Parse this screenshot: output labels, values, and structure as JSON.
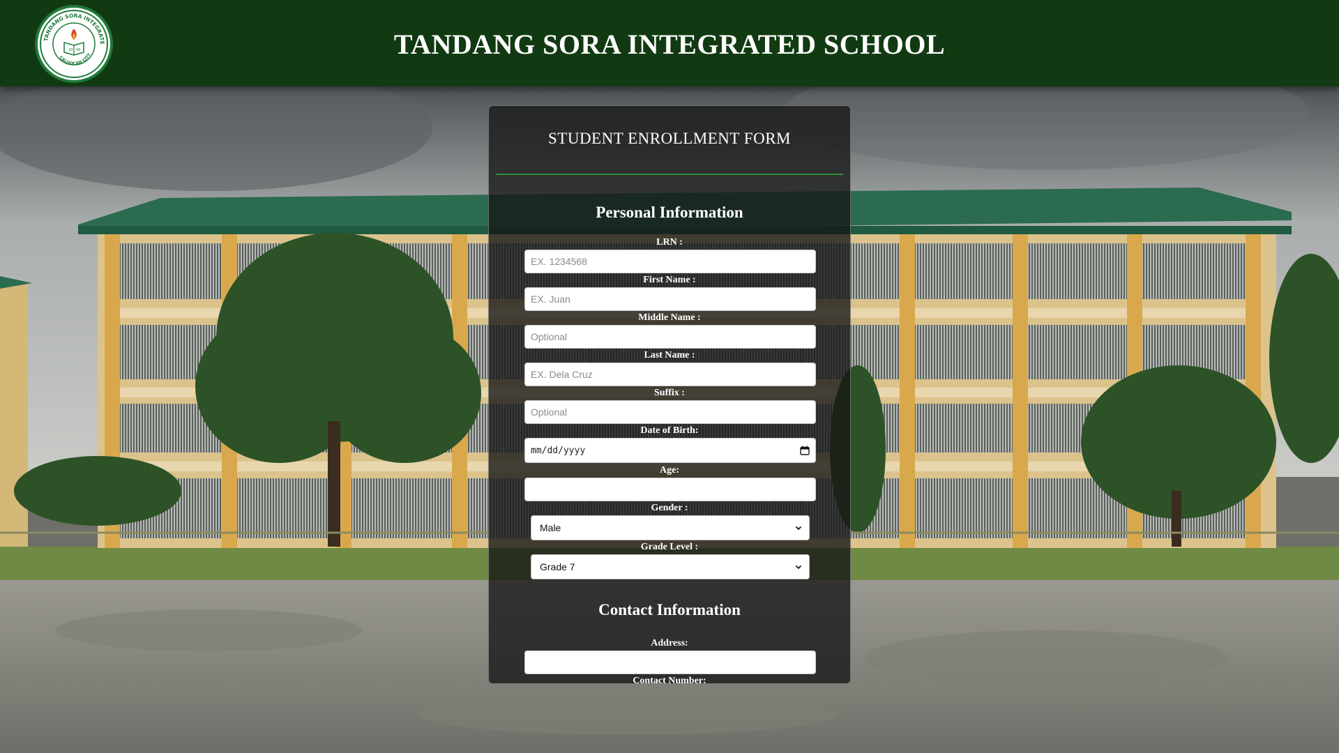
{
  "header": {
    "school_name": "TANDANG SORA INTEGRATED SCHOOL",
    "logo": {
      "ring_text": "TANDANG SORA INTEGRATED SCHOOL",
      "city_text": "CALOOCAN CITY",
      "year_left": "20",
      "year_right": "56"
    },
    "colors": {
      "bar": "#123a12",
      "text": "#ffffff"
    }
  },
  "form": {
    "title": "STUDENT ENROLLMENT FORM",
    "accent_color": "#2f8f3a",
    "personal": {
      "title": "Personal Information",
      "lrn": {
        "label": "LRN :",
        "placeholder": "EX. 1234568",
        "value": ""
      },
      "first_name": {
        "label": "First Name :",
        "placeholder": "EX. Juan",
        "value": ""
      },
      "middle_name": {
        "label": "Middle Name :",
        "placeholder": "Optional",
        "value": ""
      },
      "last_name": {
        "label": "Last Name :",
        "placeholder": "EX. Dela Cruz",
        "value": ""
      },
      "suffix": {
        "label": "Suffix :",
        "placeholder": "Optional",
        "value": ""
      },
      "dob": {
        "label": "Date of Birth:",
        "placeholder": "mm/dd/yyyy",
        "icon": "calendar-icon"
      },
      "age": {
        "label": "Age:",
        "value": ""
      },
      "gender": {
        "label": "Gender :",
        "selected": "Male",
        "icon": "chevron-down-icon"
      },
      "grade_level": {
        "label": "Grade Level :",
        "selected": "Grade 7",
        "icon": "chevron-down-icon"
      }
    },
    "contact": {
      "title": "Contact Information",
      "address": {
        "label": "Address:",
        "value": ""
      },
      "contact_number": {
        "label": "Contact Number:"
      }
    }
  }
}
